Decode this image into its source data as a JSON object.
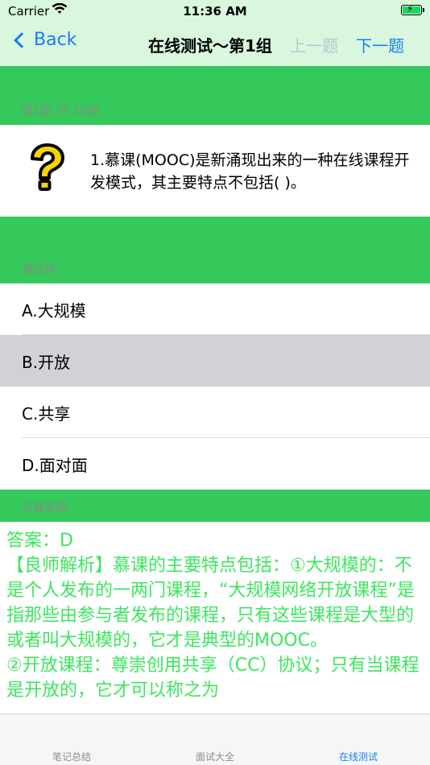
{
  "status_bar": {
    "carrier": "Carrier",
    "time": "11:36 AM"
  },
  "nav": {
    "back_label": "Back",
    "title": "在线测试～第1组",
    "prev_label": "上一题",
    "next_label": "下一题"
  },
  "question": {
    "progress": "第1题 /共 10题",
    "text": "1.慕课(MOOC)是新涌现出来的一种在线课程开发模式，其主要特点不包括(   )。"
  },
  "choices": {
    "prompt": "请选择:",
    "options": [
      {
        "label": "A.大规模"
      },
      {
        "label": "B.开放"
      },
      {
        "label": "C.共享"
      },
      {
        "label": "D.面对面"
      }
    ],
    "selected_index": 1
  },
  "answer": {
    "heading": "正确答案:",
    "line1": "答案：D",
    "line2": "【良师解析】慕课的主要特点包括：①大规模的：不是个人发布的一两门课程，“大规模网络开放课程”是指那些由参与者发布的课程，只有这些课程是大型的或者叫大规模的，它才是典型的MOOC。",
    "line3": "②开放课程：尊崇创用共享（CC）协议；只有当课程是开放的，它才可以称之为"
  },
  "tabs": [
    {
      "label": "笔记总结",
      "active": false
    },
    {
      "label": "面试大全",
      "active": false
    },
    {
      "label": "在线测试",
      "active": true
    }
  ],
  "colors": {
    "accent": "#1a7cf5",
    "band_green": "#35c85a",
    "nav_bg": "#d9f7dd",
    "answer_text": "#3ce65e",
    "selected_bg": "#d1d1d6"
  },
  "icons": {
    "question": "question-mark-icon",
    "back": "chevron-left-icon",
    "wifi": "wifi-icon",
    "battery": "battery-charging-icon"
  }
}
